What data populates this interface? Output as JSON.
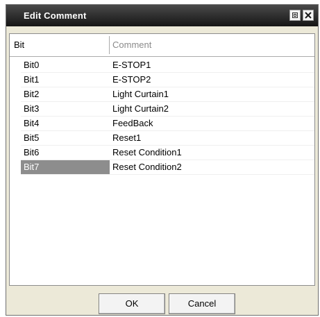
{
  "window": {
    "title": "Edit Comment"
  },
  "table": {
    "columns": {
      "bit": "Bit",
      "comment": "Comment"
    },
    "rows": [
      {
        "bit": "Bit0",
        "comment": "E-STOP1"
      },
      {
        "bit": "Bit1",
        "comment": "E-STOP2"
      },
      {
        "bit": "Bit2",
        "comment": "Light Curtain1"
      },
      {
        "bit": "Bit3",
        "comment": "Light Curtain2"
      },
      {
        "bit": "Bit4",
        "comment": "FeedBack"
      },
      {
        "bit": "Bit5",
        "comment": "Reset1"
      },
      {
        "bit": "Bit6",
        "comment": "Reset Condition1"
      },
      {
        "bit": "Bit7",
        "comment": "Reset Condition2"
      }
    ],
    "selected_row_index": 7
  },
  "buttons": {
    "ok": "OK",
    "cancel": "Cancel"
  },
  "icons": {
    "restore": "restore-icon",
    "close": "close-icon"
  },
  "colors": {
    "titlebar": "#1f1f1f",
    "selection": "#8d8d8d",
    "dialog_background": "#ece9d8"
  }
}
